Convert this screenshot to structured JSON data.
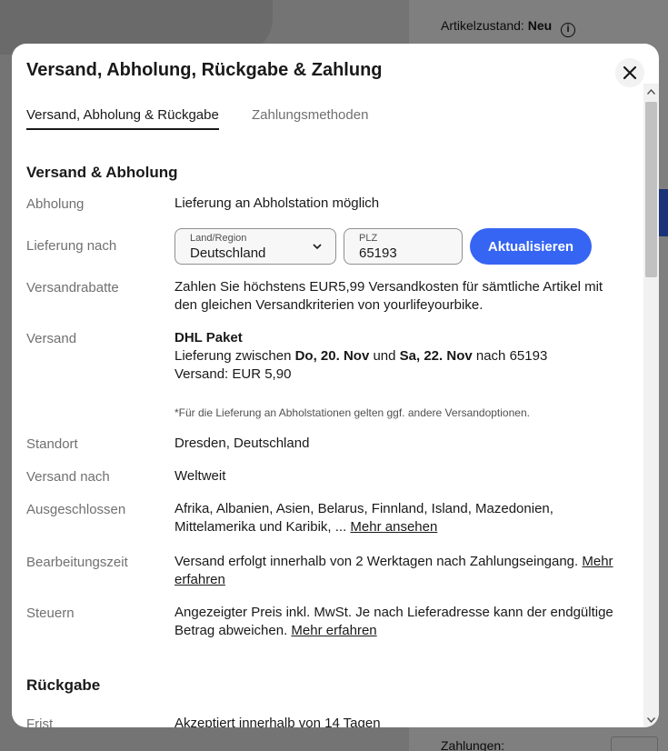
{
  "background": {
    "condition_label": "Artikelzustand:",
    "condition_value": "Neu",
    "payments_label": "Zahlungen:"
  },
  "modal": {
    "title": "Versand, Abholung, Rückgabe & Zahlung",
    "tabs": [
      {
        "label": "Versand, Abholung & Rückgabe",
        "active": true
      },
      {
        "label": "Zahlungsmethoden",
        "active": false
      }
    ],
    "shipping_section": {
      "title": "Versand & Abholung",
      "pickup_label": "Abholung",
      "pickup_value": "Lieferung an Abholstation möglich",
      "delivery_label": "Lieferung nach",
      "country_field_label": "Land/Region",
      "country_value": "Deutschland",
      "zip_field_label": "PLZ",
      "zip_value": "65193",
      "update_button": "Aktualisieren",
      "discount_label": "Versandrabatte",
      "discount_value": "Zahlen Sie höchstens EUR5,99 Versandkosten für sämtliche Artikel mit den gleichen Versandkriterien von yourlifeyourbike.",
      "shipping_label": "Versand",
      "carrier": "DHL Paket",
      "delivery_prefix": "Lieferung zwischen",
      "delivery_from": "Do, 20. Nov",
      "delivery_and": "und",
      "delivery_to": "Sa, 22. Nov",
      "delivery_suffix": "nach 65193",
      "shipping_cost": "Versand: EUR 5,90",
      "pickup_note": "*Für die Lieferung an Abholstationen gelten ggf. andere Versandoptionen.",
      "location_label": "Standort",
      "location_value": "Dresden, Deutschland",
      "ships_to_label": "Versand nach",
      "ships_to_value": "Weltweit",
      "excluded_label": "Ausgeschlossen",
      "excluded_value": "Afrika, Albanien, Asien, Belarus, Finnland, Island, Mazedonien, Mittelamerika und Karibik, ...",
      "excluded_link": "Mehr ansehen",
      "handling_label": "Bearbeitungszeit",
      "handling_value": "Versand erfolgt innerhalb von 2 Werktagen nach Zahlungseingang.",
      "handling_link": "Mehr erfahren",
      "tax_label": "Steuern",
      "tax_value": "Angezeigter Preis inkl. MwSt. Je nach Lieferadresse kann der endgültige Betrag abweichen.",
      "tax_link": "Mehr erfahren"
    },
    "returns_section": {
      "title": "Rückgabe",
      "period_label": "Frist",
      "period_value": "Akzeptiert innerhalb von 14 Tagen"
    }
  }
}
